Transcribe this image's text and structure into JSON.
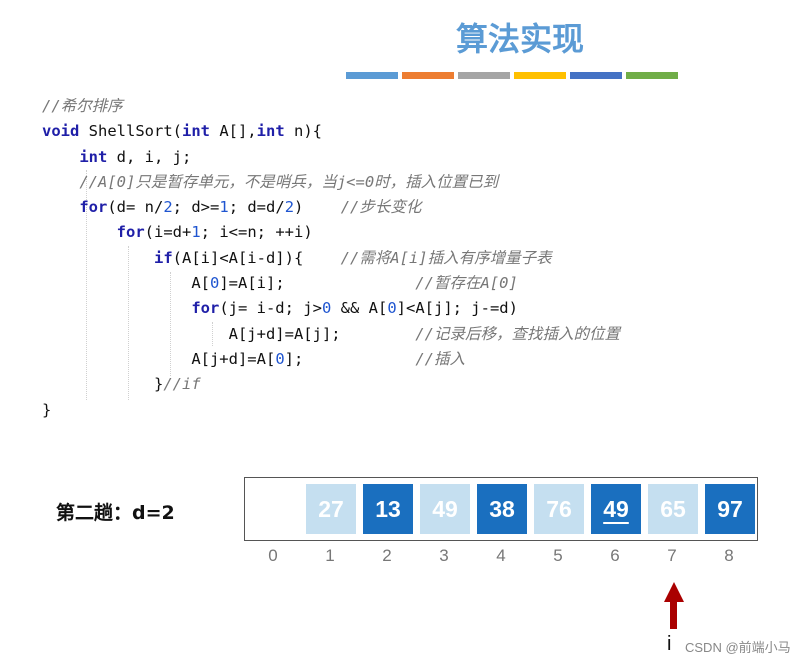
{
  "title": "算法实现",
  "colors": [
    "#5b9bd5",
    "#ed7d31",
    "#a5a5a5",
    "#ffc000",
    "#4472c4",
    "#70ad47"
  ],
  "code": {
    "line1": {
      "comment": "//希尔排序"
    },
    "line2": {
      "kw1": "void",
      "t1": " ShellSort(",
      "kw2": "int",
      "t2": " A[],",
      "kw3": "int",
      "t3": " n){"
    },
    "line3": {
      "kw1": "int",
      "t1": " d, i, j;"
    },
    "line4": {
      "comment": "//A[0]只是暂存单元，不是哨兵，当j<=0时，插入位置已到"
    },
    "line5": {
      "kw1": "for",
      "t1": "(d= n/",
      "n1": "2",
      "t2": "; d>=",
      "n2": "1",
      "t3": "; d=d/",
      "n3": "2",
      "t4": ")    ",
      "comment": "//步长变化"
    },
    "line6": {
      "kw1": "for",
      "t1": "(i=d+",
      "n1": "1",
      "t2": "; i<=n; ++i)"
    },
    "line7": {
      "kw1": "if",
      "t1": "(A[i]<A[i-d]){    ",
      "comment": "//需将A[i]插入有序增量子表"
    },
    "line8": {
      "t1": "A[",
      "n1": "0",
      "t2": "]=A[i];              ",
      "comment": "//暂存在A[0]"
    },
    "line9": {
      "kw1": "for",
      "t1": "(j= i-d; j>",
      "n1": "0",
      "t2": " && A[",
      "n2": "0",
      "t3": "]<A[j]; j-=d)"
    },
    "line10": {
      "t1": "A[j+d]=A[j];        ",
      "comment": "//记录后移，查找插入的位置"
    },
    "line11": {
      "t1": "A[j+d]=A[",
      "n1": "0",
      "t2": "];            ",
      "comment": "//插入"
    },
    "line12": {
      "t1": "}",
      "comment": "//if"
    },
    "line13": {
      "t1": "}"
    }
  },
  "pass_label": "第二趟：d=2",
  "array": {
    "cells": [
      "",
      "27",
      "13",
      "49",
      "38",
      "76",
      "49",
      "65",
      "97"
    ],
    "indices": [
      "0",
      "1",
      "2",
      "3",
      "4",
      "5",
      "6",
      "7",
      "8"
    ]
  },
  "pointer_label": "i",
  "watermark": "CSDN @前端小马"
}
